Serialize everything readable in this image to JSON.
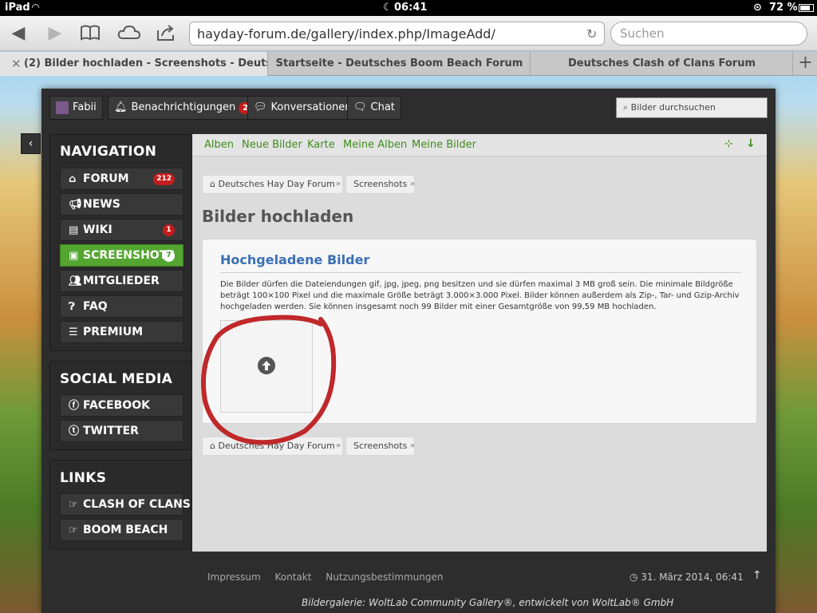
{
  "status_bar": {
    "device": "iPad",
    "time": "06:41",
    "battery": "72 %"
  },
  "browser": {
    "url": "hayday-forum.de/gallery/index.php/ImageAdd/",
    "search_placeholder": "Suchen",
    "tabs": [
      {
        "label": "(2) Bilder hochladen - Screenshots - Deutsc..."
      },
      {
        "label": "Startseite - Deutsches Boom Beach Forum"
      },
      {
        "label": "Deutsches Clash of Clans Forum"
      }
    ]
  },
  "header": {
    "user": "Fabii",
    "notifications_label": "Benachrichtigungen",
    "notifications_count": "2",
    "conversations_label": "Konversationen",
    "chat_label": "Chat",
    "search_placeholder": "Bilder durchsuchen"
  },
  "sidebar": {
    "navigation_title": "NAVIGATION",
    "nav_items": [
      {
        "label": "FORUM",
        "badge": "212"
      },
      {
        "label": "NEWS"
      },
      {
        "label": "WIKI",
        "badge": "1"
      },
      {
        "label": "SCREENSHOTS",
        "badge": "7"
      },
      {
        "label": "MITGLIEDER"
      },
      {
        "label": "FAQ"
      },
      {
        "label": "PREMIUM"
      }
    ],
    "social_title": "SOCIAL MEDIA",
    "social_items": [
      {
        "label": "FACEBOOK"
      },
      {
        "label": "TWITTER"
      }
    ],
    "links_title": "LINKS",
    "link_items": [
      {
        "label": "CLASH OF CLANS"
      },
      {
        "label": "BOOM BEACH"
      }
    ]
  },
  "subnav": {
    "items": [
      "Alben",
      "Neue Bilder",
      "Karte",
      "Meine Alben",
      "Meine Bilder"
    ]
  },
  "breadcrumb": {
    "home": "Deutsches Hay Day Forum",
    "section": "Screenshots"
  },
  "page": {
    "title": "Bilder hochladen",
    "panel_title": "Hochgeladene Bilder",
    "panel_text": "Die Bilder dürfen die Dateiendungen gif, jpg, jpeg, png besitzen und sie dürfen maximal 3 MB groß sein. Die minimale Bildgröße beträgt 100×100 Pixel und die maximale Größe beträgt 3.000×3.000 Pixel. Bilder können außerdem als Zip-, Tar- und Gzip-Archiv hochgeladen werden. Sie können insgesamt noch 99 Bilder mit einer Gesamtgröße von 99,59 MB hochladen."
  },
  "footer": {
    "links": [
      "Impressum",
      "Kontakt",
      "Nutzungsbestimmungen"
    ],
    "date": "31. März 2014, 06:41",
    "credit": "Bildergalerie: WoltLab Community Gallery®, entwickelt von WoltLab® GmbH"
  },
  "colors": {
    "accent_green": "#54a631",
    "link_blue": "#3a6fb7",
    "badge_red": "#c41d1d",
    "annotation_red": "#c0282a"
  }
}
